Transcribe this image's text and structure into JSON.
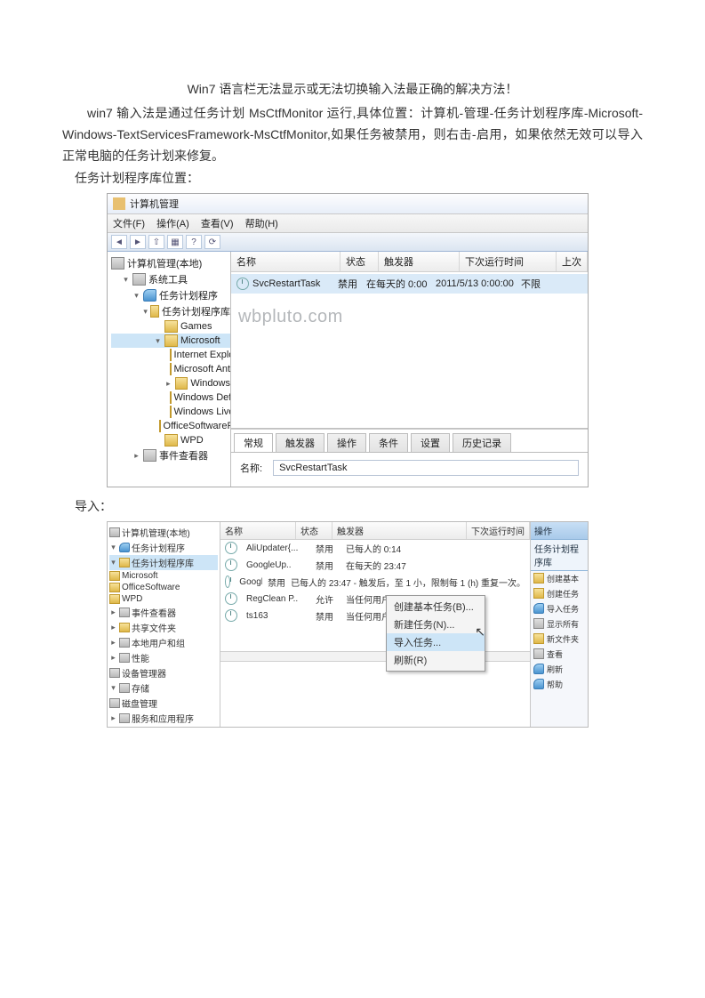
{
  "doc": {
    "title": "Win7 语言栏无法显示或无法切换输入法最正确的解决方法！",
    "para1": "win7 输入法是通过任务计划 MsCtfMonitor 运行,具体位置：计算机-管理-任务计划程序库-Microsoft-Windows-TextServicesFramework-MsCtfMonitor,如果任务被禁用，则右击-启用，如果依然无效可以导入正常电脑的任务计划来修复。",
    "para2": "任务计划程序库位置：",
    "para3": "导入："
  },
  "sc1": {
    "title": "计算机管理",
    "menu": {
      "file": "文件(F)",
      "action": "操作(A)",
      "view": "查看(V)",
      "help": "帮助(H)"
    },
    "tree": {
      "root": "计算机管理(本地)",
      "systools": "系统工具",
      "sched": "任务计划程序",
      "lib": "任务计划程序库",
      "games": "Games",
      "ms": "Microsoft",
      "ie": "Internet Explorer",
      "antimal": "Microsoft Antimalz",
      "win": "Windows",
      "def": "Windows Defender",
      "live": "Windows Live",
      "osp": "OfficeSoftwareProtect",
      "wpd": "WPD",
      "eventv": "事件查看器"
    },
    "headers": {
      "name": "名称",
      "status": "状态",
      "trigger": "触发器",
      "next": "下次运行时间",
      "last": "上次"
    },
    "row": {
      "name": "SvcRestartTask",
      "status": "禁用",
      "trigger": "在每天的 0:00",
      "next": "2011/5/13 0:00:00",
      "last": "不限"
    },
    "watermark": "wbpluto.com",
    "tabs": {
      "general": "常规",
      "triggers": "触发器",
      "actions": "操作",
      "conditions": "条件",
      "settings": "设置",
      "history": "历史记录"
    },
    "nameLabel": "名称:",
    "nameVal": "SvcRestartTask"
  },
  "sc2": {
    "tree": {
      "root": "计算机管理(本地)",
      "sched": "任务计划程序",
      "lib": "任务计划程序库",
      "ms": "Microsoft",
      "osw": "OfficeSoftware",
      "wpd": "WPD",
      "ev": "事件查看器",
      "sf": "共享文件夹",
      "lu": "本地用户和组",
      "perf": "性能",
      "dev": "设备管理器",
      "stg": "存储",
      "dm": "磁盘管理",
      "svc": "服务和应用程序"
    },
    "headers": {
      "name": "名称",
      "status": "状态",
      "trigger": "触发器",
      "next": "下次运行时间"
    },
    "rows": [
      {
        "name": "AliUpdater{...",
        "status": "禁用",
        "trigger": "已每人的 0:14"
      },
      {
        "name": "GoogleUp..",
        "status": "禁用",
        "trigger": "在每天的 23:47"
      },
      {
        "name": "GoogleUp..",
        "status": "禁用",
        "trigger": "已每人的 23:47 - 触发后，至 1 小，限制每 1 (h) 重复一次。"
      },
      {
        "name": "RegClean P..",
        "status": "允许",
        "trigger": "当任何用户登录时"
      },
      {
        "name": "ts163",
        "status": "禁用",
        "trigger": "当任何用户登录时"
      }
    ],
    "ctx": {
      "create": "创建基本任务(B)...",
      "createn": "新建任务(N)...",
      "import": "导入任务...",
      "refresh": "刷新(R)"
    },
    "rhead": "操作",
    "rsub": "任务计划程序库",
    "ritems": [
      "创建基本",
      "创建任务",
      "导入任务",
      "显示所有",
      "新文件夹",
      "查看",
      "刷新",
      "帮助"
    ]
  }
}
